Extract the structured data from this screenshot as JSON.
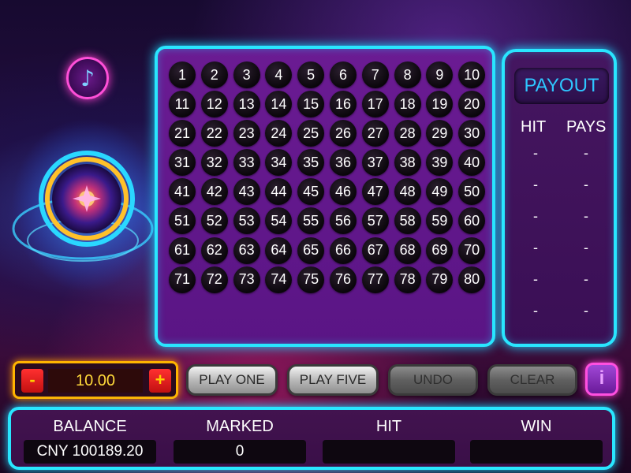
{
  "music_icon": "♪",
  "grid_numbers": [
    "1",
    "2",
    "3",
    "4",
    "5",
    "6",
    "7",
    "8",
    "9",
    "10",
    "11",
    "12",
    "13",
    "14",
    "15",
    "16",
    "17",
    "18",
    "19",
    "20",
    "21",
    "22",
    "23",
    "24",
    "25",
    "26",
    "27",
    "28",
    "29",
    "30",
    "31",
    "32",
    "33",
    "34",
    "35",
    "36",
    "37",
    "38",
    "39",
    "40",
    "41",
    "42",
    "43",
    "44",
    "45",
    "46",
    "47",
    "48",
    "49",
    "50",
    "51",
    "52",
    "53",
    "54",
    "55",
    "56",
    "57",
    "58",
    "59",
    "60",
    "61",
    "62",
    "63",
    "64",
    "65",
    "66",
    "67",
    "68",
    "69",
    "70",
    "71",
    "72",
    "73",
    "74",
    "75",
    "76",
    "77",
    "78",
    "79",
    "80"
  ],
  "payout": {
    "title": "PAYOUT",
    "hit_header": "HIT",
    "pays_header": "PAYS",
    "rows": [
      {
        "hit": "-",
        "pays": "-"
      },
      {
        "hit": "-",
        "pays": "-"
      },
      {
        "hit": "-",
        "pays": "-"
      },
      {
        "hit": "-",
        "pays": "-"
      },
      {
        "hit": "-",
        "pays": "-"
      },
      {
        "hit": "-",
        "pays": "-"
      }
    ]
  },
  "bet": {
    "minus_label": "-",
    "plus_label": "+",
    "value": "10.00"
  },
  "actions": {
    "play_one": "PLAY ONE",
    "play_five": "PLAY FIVE",
    "undo": "UNDO",
    "clear": "CLEAR",
    "info": "i"
  },
  "status": {
    "balance_label": "BALANCE",
    "balance_value": "CNY 100189.20",
    "marked_label": "MARKED",
    "marked_value": "0",
    "hit_label": "HIT",
    "hit_value": "",
    "win_label": "WIN",
    "win_value": ""
  },
  "colors": {
    "neon_cyan": "#29e6ff",
    "neon_pink": "#ff4fd8",
    "grid_purple": "#6b1b93",
    "bet_gold": "#ffb400",
    "payout_blue": "#2ec6ff"
  }
}
